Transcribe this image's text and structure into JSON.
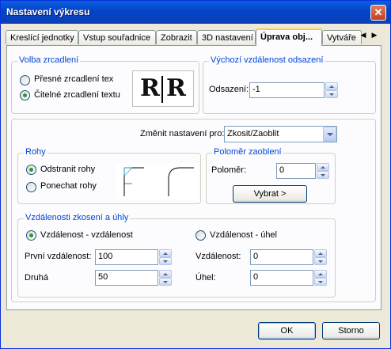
{
  "window": {
    "title": "Nastavení výkresu",
    "close_glyph": "✕"
  },
  "tabs": [
    {
      "label": "Kreslící jednotky"
    },
    {
      "label": "Vstup souřadnice"
    },
    {
      "label": "Zobrazit"
    },
    {
      "label": "3D nastavení"
    },
    {
      "label": "Úprava obj..."
    },
    {
      "label": "Vytváře"
    }
  ],
  "tab_scroll": {
    "left": "◀",
    "right": "▶"
  },
  "mirror": {
    "title": "Volba zrcadlení",
    "options": [
      {
        "label": "Přesné zrcadlení tex",
        "selected": false
      },
      {
        "label": "Čitelné zrcadlení textu",
        "selected": true
      }
    ],
    "preview_left": "R",
    "preview_right": "R"
  },
  "offset": {
    "title": "Výchozí vzdálenost odsazení",
    "label": "Odsazení:",
    "value": "-1"
  },
  "change_settings": {
    "label": "Změnit nastavení pro:",
    "selected": "Zkosit/Zaoblit"
  },
  "corners": {
    "title": "Rohy",
    "options": [
      {
        "label": "Odstranit rohy",
        "selected": true
      },
      {
        "label": "Ponechat rohy",
        "selected": false
      }
    ]
  },
  "radius": {
    "title": "Poloměr zaoblení",
    "label": "Poloměr:",
    "value": "0",
    "select_button": "Vybrat  >"
  },
  "chamfer": {
    "title": "Vzdálenosti zkosení a úhly",
    "option_dist": "Vzdálenost - vzdálenost",
    "option_dist_selected": true,
    "option_angle": "Vzdálenost - úhel",
    "option_angle_selected": false,
    "first_label": "První vzdálenost:",
    "first_value": "100",
    "second_label": "Druhá",
    "second_value": "50",
    "dist_label": "Vzdálenost:",
    "dist_value": "0",
    "angle_label": "Úhel:",
    "angle_value": "0"
  },
  "buttons": {
    "ok": "OK",
    "cancel": "Storno"
  },
  "colors": {
    "titlebar": "#0A5FE0",
    "group_title": "#0046D5",
    "radio_dot": "#21A121",
    "tab_highlight": "#FFC83C"
  }
}
